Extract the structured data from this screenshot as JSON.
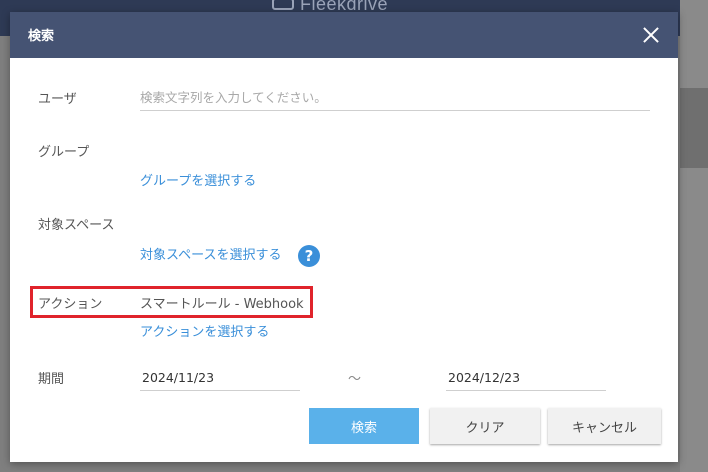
{
  "background": {
    "app_name": "Fleekdrive"
  },
  "dialog": {
    "title": "検索",
    "close_icon": "close-icon"
  },
  "form": {
    "user": {
      "label": "ユーザ",
      "placeholder": "検索文字列を入力してください。",
      "value": ""
    },
    "group": {
      "label": "グループ",
      "link": "グループを選択する"
    },
    "space": {
      "label": "対象スペース",
      "link": "対象スペースを選択する",
      "help_icon": "question-circle-icon"
    },
    "action": {
      "label": "アクション",
      "value": "スマートルール - Webhook",
      "link": "アクションを選択する"
    },
    "period": {
      "label": "期間",
      "from": "2024/11/23",
      "separator": "～",
      "to": "2024/12/23"
    }
  },
  "buttons": {
    "search": "検索",
    "clear": "クリア",
    "cancel": "キャンセル"
  },
  "colors": {
    "header": "#455373",
    "link": "#3a8fd9",
    "primary_button": "#5ab1ea",
    "highlight": "#e0232b"
  }
}
